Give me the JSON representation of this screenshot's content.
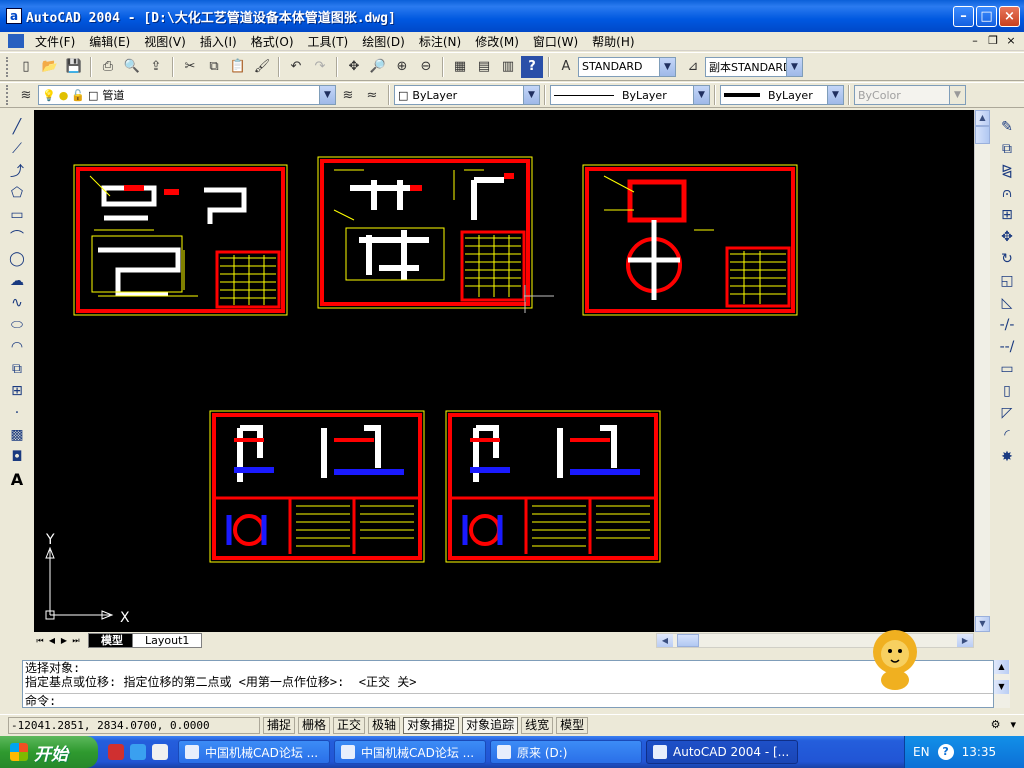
{
  "window": {
    "app_icon": "a",
    "title": "AutoCAD 2004 - [D:\\大化工艺管道设备本体管道图张.dwg]",
    "buttons": [
      "minimize-icon",
      "maximize-icon",
      "close-icon"
    ]
  },
  "menu": {
    "items": [
      "文件(F)",
      "编辑(E)",
      "视图(V)",
      "插入(I)",
      "格式(O)",
      "工具(T)",
      "绘图(D)",
      "标注(N)",
      "修改(M)",
      "窗口(W)",
      "帮助(H)"
    ]
  },
  "toolbar_std": {
    "text_style": "STANDARD",
    "dim_style": "副本STANDARD"
  },
  "toolbar_props": {
    "layer": "管道",
    "color": "ByLayer",
    "linetype": "ByLayer",
    "lineweight": "ByLayer",
    "plotstyle": "ByColor"
  },
  "canvas": {
    "ucs_y": "Y",
    "ucs_x": "X",
    "background": "#000000",
    "colors": {
      "border": "#ff0000",
      "frame": "#ffff00",
      "pipe": "#ffffff",
      "blue": "#1a1aff"
    }
  },
  "tabs": {
    "model": "模型",
    "layout": "Layout1"
  },
  "command": {
    "line1": "选择对象:",
    "line2": "指定基点或位移: 指定位移的第二点或 <用第一点作位移>:  <正交 关>",
    "prompt": "命令:"
  },
  "status": {
    "coords": "-12041.2851, 2834.0700, 0.0000",
    "buttons": [
      "捕捉",
      "栅格",
      "正交",
      "极轴",
      "对象捕捉",
      "对象追踪",
      "线宽",
      "模型"
    ]
  },
  "taskbar": {
    "start": "开始",
    "tasks": [
      "中国机械CAD论坛 ...",
      "中国机械CAD论坛 ...",
      "原来 (D:)",
      "AutoCAD 2004 - [..."
    ],
    "lang": "EN",
    "time": "13:35"
  }
}
